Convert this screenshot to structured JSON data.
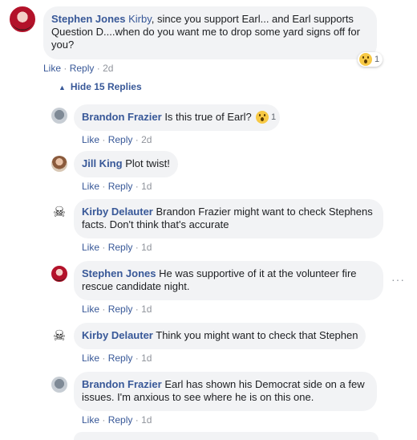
{
  "comments": [
    {
      "author": "Stephen Jones",
      "mention": "Kirby",
      "text": ", since you support Earl... and Earl supports Question D....when do you want me to drop some yard signs off for you?",
      "like": "Like",
      "reply": "Reply",
      "time": "2d",
      "reaction_count": "1"
    }
  ],
  "hide_replies": "Hide 15 Replies",
  "replies": [
    {
      "author": "Brandon Frazier",
      "text": "Is this true of Earl?",
      "like": "Like",
      "reply": "Reply",
      "time": "2d",
      "reaction_count": "1"
    },
    {
      "author": "Jill King",
      "text": "Plot twist!",
      "like": "Like",
      "reply": "Reply",
      "time": "1d"
    },
    {
      "author": "Kirby Delauter",
      "text": "Brandon Frazier might want to check Stephens facts. Don't think that's accurate",
      "like": "Like",
      "reply": "Reply",
      "time": "1d"
    },
    {
      "author": "Stephen Jones",
      "text": "He was supportive of it at the volunteer fire rescue candidate night.",
      "like": "Like",
      "reply": "Reply",
      "time": "1d"
    },
    {
      "author": "Kirby Delauter",
      "text": "Think you might want to check that Stephen",
      "like": "Like",
      "reply": "Reply",
      "time": "1d"
    },
    {
      "author": "Brandon Frazier",
      "text": "Earl has shown his Democrat side on a few issues. I'm anxious to see where he is on this one.",
      "like": "Like",
      "reply": "Reply",
      "time": "1d"
    }
  ],
  "more_glyph": "···"
}
